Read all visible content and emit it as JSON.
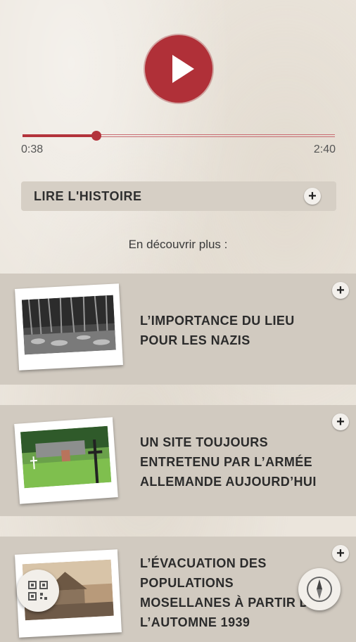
{
  "player": {
    "current_time": "0:38",
    "total_time": "2:40",
    "progress": 0.2375,
    "accent_color": "#b03038"
  },
  "read_story": {
    "label": "LIRE L'HISTOIRE"
  },
  "discover_label": "En découvrir plus :",
  "cards": [
    {
      "title_lines": [
        "L’IMPORTANCE DU LIEU",
        "POUR LES NAZIS"
      ],
      "photo": "forest-photo"
    },
    {
      "title_lines": [
        "UN SITE TOUJOURS",
        "ENTRETENU PAR L’ARMÉE",
        "ALLEMANDE AUJOURD’HUI"
      ],
      "photo": "cemetery-photo"
    },
    {
      "title_lines": [
        "L’ÉVACUATION DES",
        "POPULATIONS",
        "MOSELLANES À PARTIR DE",
        "L’AUTOMNE 1939"
      ],
      "photo": "village-photo"
    }
  ],
  "icons": {
    "play": "play-icon",
    "plus": "plus-icon",
    "qr": "qr-code-icon",
    "compass": "compass-icon"
  }
}
